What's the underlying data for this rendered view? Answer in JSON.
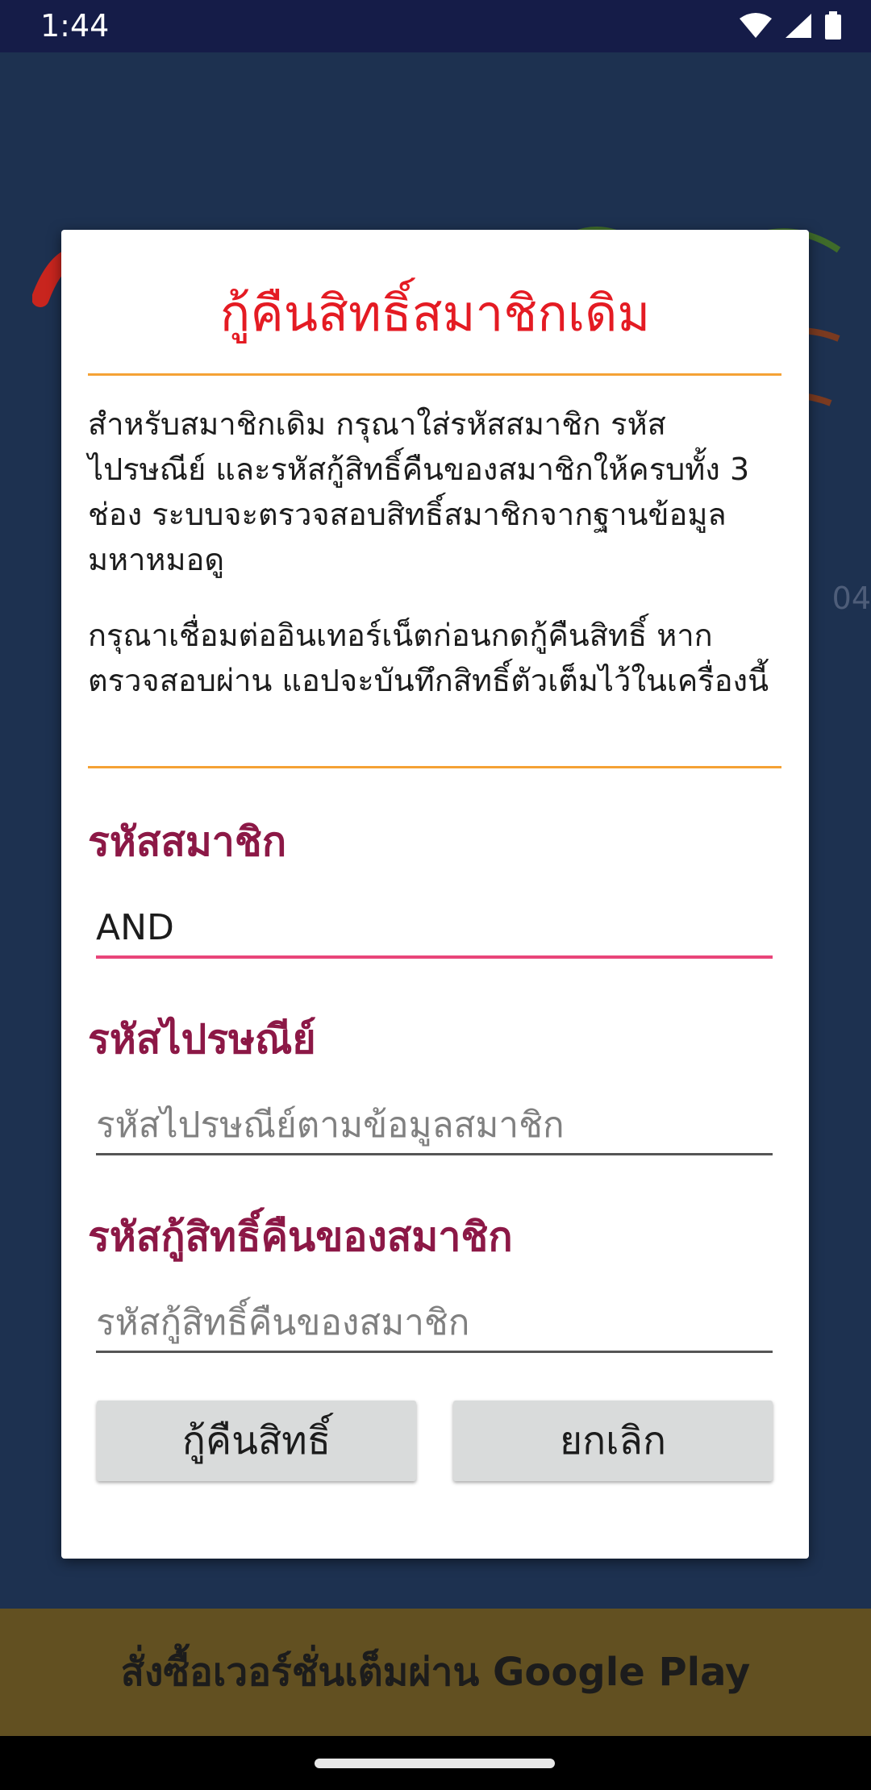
{
  "status_bar": {
    "time": "1:44",
    "icons": [
      "wifi-icon",
      "signal-icon",
      "battery-icon"
    ]
  },
  "background": {
    "version_fragment": "04"
  },
  "dialog": {
    "title": "กู้คืนสิทธิ์สมาชิกเดิม",
    "paragraph1": "สำหรับสมาชิกเดิม กรุณาใส่รหัสสมาชิก รหัสไปรษณีย์ และรหัสกู้สิทธิ์คืนของสมาชิกให้ครบทั้ง 3 ช่อง ระบบจะตรวจสอบสิทธิ์สมาชิกจากฐานข้อมูลมหาหมอดู",
    "paragraph2": "กรุณาเชื่อมต่ออินเทอร์เน็ตก่อนกดกู้คืนสิทธิ์ หากตรวจสอบผ่าน แอปจะบันทึกสิทธิ์ตัวเต็มไว้ในเครื่องนี้",
    "member_id": {
      "label": "รหัสสมาชิก",
      "value": "AND",
      "placeholder": ""
    },
    "postal_code": {
      "label": "รหัสไปรษณีย์",
      "value": "",
      "placeholder": "รหัสไปรษณีย์ตามข้อมูลสมาชิก"
    },
    "recovery_code": {
      "label": "รหัสกู้สิทธิ์คืนของสมาชิก",
      "value": "",
      "placeholder": "รหัสกู้สิทธิ์คืนของสมาชิก"
    },
    "restore_button": "กู้คืนสิทธิ์",
    "cancel_button": "ยกเลิก"
  },
  "banner": {
    "text": "สั่งซื้อเวอร์ชั่นเต็มผ่าน Google Play"
  },
  "colors": {
    "title_red": "#e41b23",
    "label_maroon": "#8c1846",
    "rule_orange": "#f5a235",
    "active_underline": "#e9457a",
    "app_background": "#1d3150",
    "banner": "#625021"
  }
}
